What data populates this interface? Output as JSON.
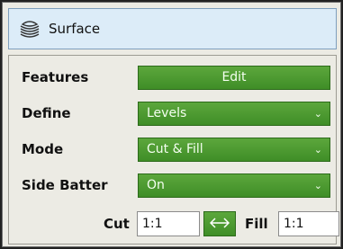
{
  "header": {
    "title": "Surface",
    "icon": "surface-layers-icon"
  },
  "rows": {
    "features": {
      "label": "Features",
      "button": "Edit"
    },
    "define": {
      "label": "Define",
      "value": "Levels"
    },
    "mode": {
      "label": "Mode",
      "value": "Cut & Fill"
    },
    "side_batter": {
      "label": "Side Batter",
      "value": "On"
    }
  },
  "batter": {
    "cut_label": "Cut",
    "cut_value": "1:1",
    "swap_icon": "swap-arrows-icon",
    "fill_label": "Fill",
    "fill_value": "1:1"
  },
  "colors": {
    "accent": "#4a9a30",
    "header_bg": "#dcecf8",
    "panel_bg": "#ecebe4"
  }
}
